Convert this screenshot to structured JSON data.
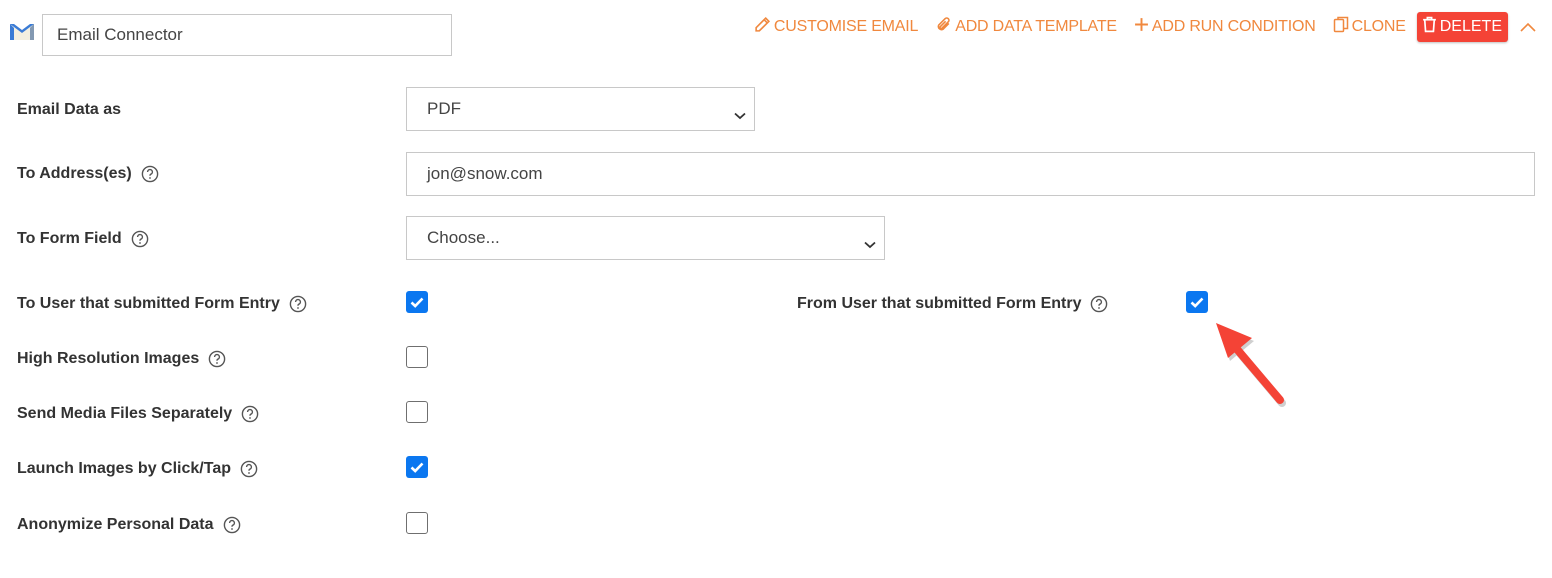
{
  "header": {
    "logo_icon": "gmail-envelope-icon",
    "connector_name": "Email Connector",
    "actions": {
      "customise_email": "CUSTOMISE EMAIL",
      "add_data_template": "ADD DATA TEMPLATE",
      "add_run_condition": "ADD RUN CONDITION",
      "clone": "CLONE",
      "delete": "DELETE"
    },
    "accent_color": "#f0883e",
    "delete_color": "#f44336"
  },
  "form": {
    "email_data_as": {
      "label": "Email Data as",
      "value": "PDF"
    },
    "to_addresses": {
      "label": "To Address(es)",
      "value": "jon@snow.com"
    },
    "to_form_field": {
      "label": "To Form Field",
      "value": "Choose..."
    },
    "to_user": {
      "label": "To User that submitted Form Entry",
      "checked": true
    },
    "from_user": {
      "label": "From User that submitted Form Entry",
      "checked": true
    },
    "high_res": {
      "label": "High Resolution Images",
      "checked": false
    },
    "send_media": {
      "label": "Send Media Files Separately",
      "checked": false
    },
    "launch_images": {
      "label": "Launch Images by Click/Tap",
      "checked": true
    },
    "anonymize": {
      "label": "Anonymize Personal Data",
      "checked": false
    }
  },
  "annotation": {
    "arrow_color": "#f44336",
    "points_to": "from_user"
  },
  "checkbox_color": "#0b77f0"
}
